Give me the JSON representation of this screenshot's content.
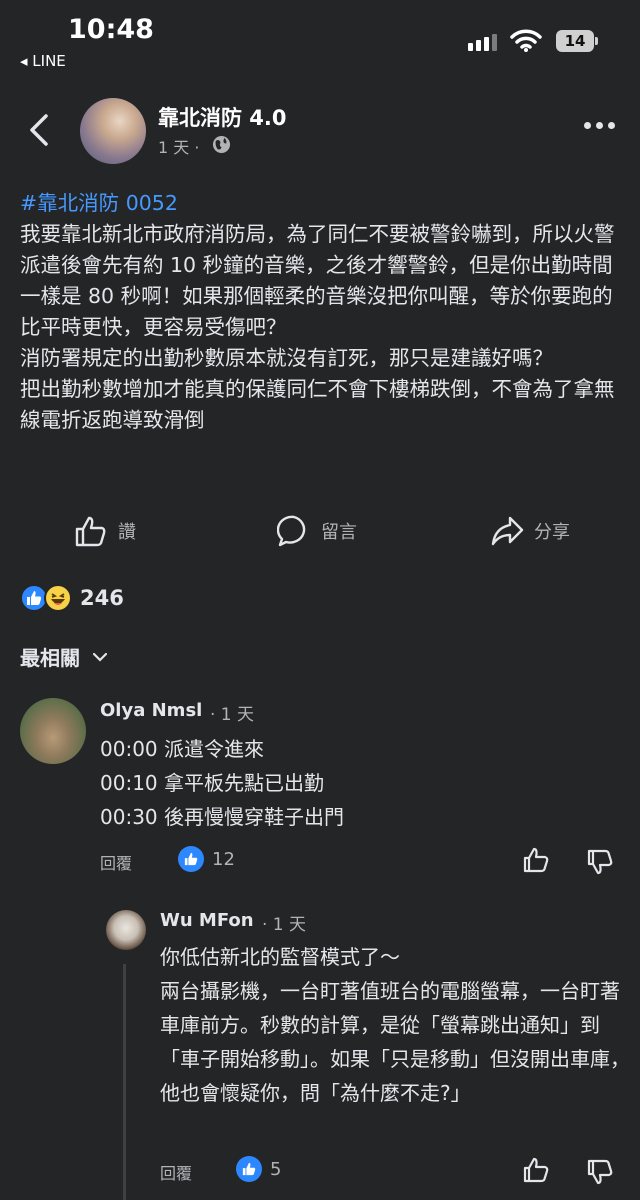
{
  "status_bar": {
    "time": "10:48",
    "back_app": "◂ LINE",
    "battery": "14"
  },
  "header": {
    "page_name": "靠北消防 4.0",
    "time_ago": "1 天 ·"
  },
  "post": {
    "hashtag": "#靠北消防 0052",
    "lines": [
      "我要靠北新北市政府消防局，為了同仁不要被警鈴嚇到，所以火警派遣後會先有約 10 秒鐘的音樂，之後才響警鈴，但是你出勤時間一樣是 80 秒啊！如果那個輕柔的音樂沒把你叫醒，等於你要跑的比平時更快，更容易受傷吧？",
      "消防署規定的出勤秒數原本就沒有訂死，那只是建議好嗎？",
      "把出勤秒數增加才能真的保護同仁不會下樓梯跌倒，不會為了拿無線電折返跑導致滑倒"
    ]
  },
  "actions": {
    "like": "讚",
    "comment": "留言",
    "share": "分享"
  },
  "reactions": {
    "count": "246"
  },
  "sort": {
    "label": "最相關"
  },
  "comments": [
    {
      "author": "Olya Nmsl",
      "time": "· 1 天",
      "lines": [
        "00:00 派遣令進來",
        "00:10 拿平板先點已出勤",
        "00:30 後再慢慢穿鞋子出門"
      ],
      "reply_label": "回覆",
      "likes": "12"
    },
    {
      "author": "Wu MFon",
      "time": "· 1 天",
      "lines": [
        "你低估新北的監督模式了～",
        "兩台攝影機，一台盯著值班台的電腦螢幕，一台盯著車庫前方。秒數的計算，是從「螢幕跳出通知」到「車子開始移動」。如果「只是移動」但沒開出車庫，他也會懷疑你，問「為什麼不走?」"
      ],
      "reply_label": "回覆",
      "likes": "5"
    }
  ]
}
